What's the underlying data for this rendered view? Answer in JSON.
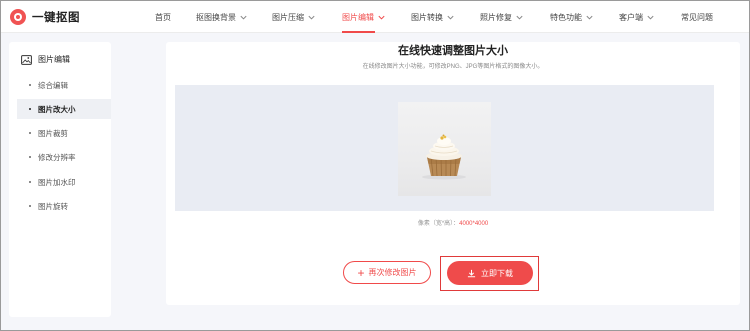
{
  "logo": {
    "text": "一键抠图"
  },
  "nav": {
    "items": [
      {
        "label": "首页",
        "has_dropdown": false,
        "active": false
      },
      {
        "label": "抠图换背景",
        "has_dropdown": true,
        "active": false
      },
      {
        "label": "图片压缩",
        "has_dropdown": true,
        "active": false
      },
      {
        "label": "图片编辑",
        "has_dropdown": true,
        "active": true
      },
      {
        "label": "图片转换",
        "has_dropdown": true,
        "active": false
      },
      {
        "label": "照片修复",
        "has_dropdown": true,
        "active": false
      },
      {
        "label": "特色功能",
        "has_dropdown": true,
        "active": false
      },
      {
        "label": "客户端",
        "has_dropdown": true,
        "active": false
      },
      {
        "label": "常见问题",
        "has_dropdown": false,
        "active": false
      }
    ]
  },
  "sidebar": {
    "heading": "图片编辑",
    "items": [
      {
        "label": "综合编辑",
        "active": false
      },
      {
        "label": "图片改大小",
        "active": true
      },
      {
        "label": "图片裁剪",
        "active": false
      },
      {
        "label": "修改分辨率",
        "active": false
      },
      {
        "label": "图片加水印",
        "active": false
      },
      {
        "label": "图片旋转",
        "active": false
      }
    ]
  },
  "main": {
    "title": "在线快速调整图片大小",
    "subtitle": "在线修改图片大小功能，可修改PNG、JPG等图片格式的图像大小。",
    "dims_label": "像素（宽*高）：",
    "dims_value": "4000*4000",
    "reedit_label": "再次修改图片",
    "download_label": "立即下载"
  },
  "colors": {
    "accent": "#f04a4a",
    "sidebar_active_bg": "#eef0f4",
    "preview_bg": "#e9ecf3",
    "page_bg": "#f5f6fa"
  }
}
